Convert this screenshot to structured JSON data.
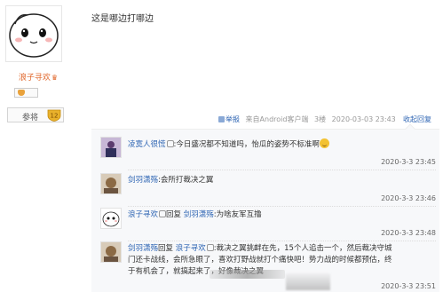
{
  "poster": {
    "username": "浪子寻欢",
    "level_label": "参将",
    "level_number": "12"
  },
  "post": {
    "content": "这是哪边打哪边",
    "report_label": "举报",
    "client_label": "来自Android客户端",
    "floor_label": "3楼",
    "timestamp": "2020-03-03 23:43",
    "collapse_label": "收起回复"
  },
  "replies": [
    {
      "name": "凌寞人很慌",
      "separator": ":",
      "text": "今日盛况都不知道吗，怡瓜的姿势不标准啊",
      "time": "2020-3-3 23:45"
    },
    {
      "name": "剑羽潇殇",
      "separator": ":",
      "text": "会所打裁决之翼",
      "time": "2020-3-3 23:46"
    },
    {
      "name": "浪子寻欢",
      "reply_word": "回复",
      "target": "剑羽潇殇",
      "separator": ":",
      "text": "为啥友军互撸",
      "time": "2020-3-3 23:48"
    },
    {
      "name": "剑羽潇殇",
      "reply_word": "回复",
      "target": "浪子寻欢",
      "separator": ":",
      "text_line1": "裁决之翼挑衅在先，15个人追击一个，然后裁决守城",
      "text_line2": "门还卡战线，会所急眼了，喜欢打野战就打个痛快吧！势力战的时候都预估，终",
      "text_line3": "于有机会了，就搞起来了，好像裁决之翼",
      "time": "2020-3-3 23:51"
    }
  ],
  "colors": {
    "link": "#2d64b3",
    "username_accent": "#e0662a",
    "level_badge": "#e9b12b"
  }
}
